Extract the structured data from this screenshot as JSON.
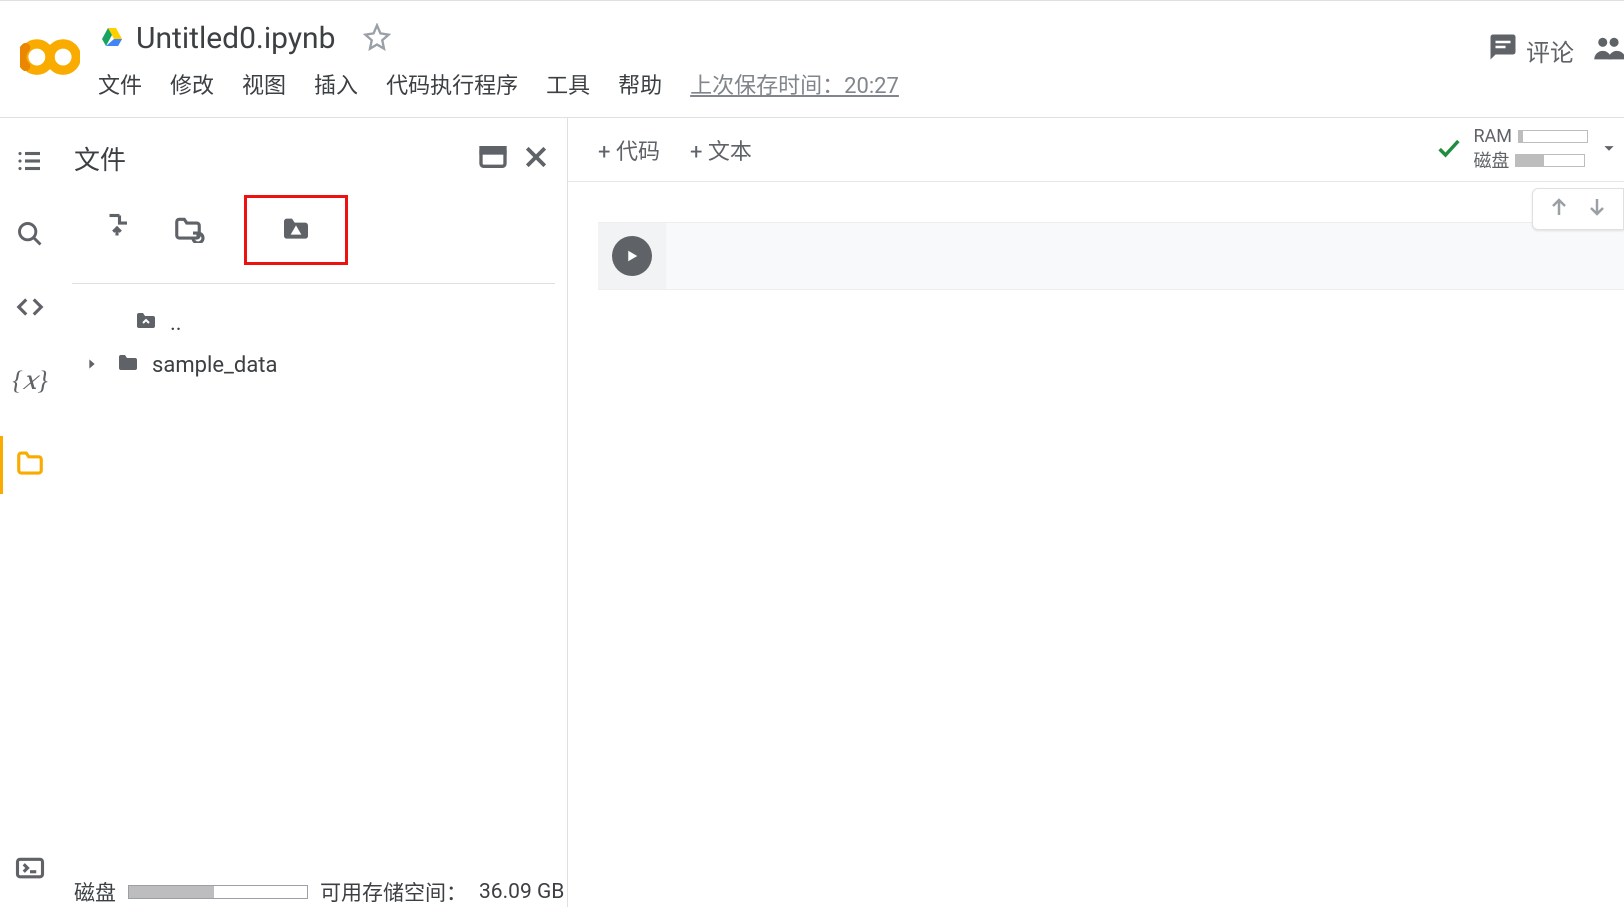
{
  "header": {
    "title": "Untitled0.ipynb",
    "menu": [
      "文件",
      "修改",
      "视图",
      "插入",
      "代码执行程序",
      "工具",
      "帮助"
    ],
    "save_status": "上次保存时间：20:27",
    "comment_label": "评论"
  },
  "file_panel": {
    "title": "文件",
    "tree": {
      "parent": "..",
      "item1": "sample_data"
    },
    "disk_label": "磁盘",
    "disk_available_label": "可用存储空间：",
    "disk_available_value": "36.09 GB",
    "disk_fill_percent": 48
  },
  "main": {
    "add_code": "+ 代码",
    "add_text": "+ 文本",
    "ram_label": "RAM",
    "disk_label": "磁盘",
    "ram_percent": 6,
    "disk_percent": 40
  }
}
